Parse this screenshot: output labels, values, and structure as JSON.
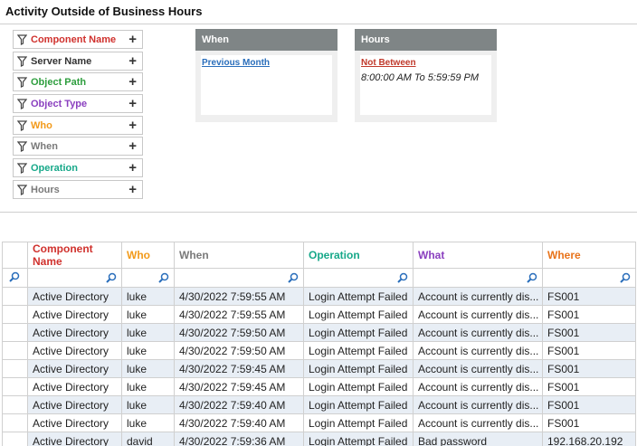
{
  "title": "Activity Outside of Business Hours",
  "colors": {
    "component": "#d0312d",
    "server": "#333333",
    "path": "#2e9e3e",
    "type": "#8a3fbf",
    "who": "#f29a1a",
    "when": "#7a7a7a",
    "operation": "#17a889",
    "hours": "#7a7a7a",
    "what": "#8a3fbf",
    "where": "#e8731a",
    "link_blue": "#2a6ebb",
    "link_red": "#c0392b"
  },
  "filters": [
    {
      "label": "Component Name",
      "plus": "+"
    },
    {
      "label": "Server Name",
      "plus": "+"
    },
    {
      "label": "Object Path",
      "plus": "+"
    },
    {
      "label": "Object Type",
      "plus": "+"
    },
    {
      "label": "Who",
      "plus": "+"
    },
    {
      "label": "When",
      "plus": "+"
    },
    {
      "label": "Operation",
      "plus": "+"
    },
    {
      "label": "Hours",
      "plus": "+"
    }
  ],
  "panels": {
    "when": {
      "title": "When",
      "link": "Previous Month"
    },
    "hours": {
      "title": "Hours",
      "link": "Not Between",
      "value": "8:00:00 AM To 5:59:59 PM"
    }
  },
  "grid": {
    "columns": [
      "Component Name",
      "Who",
      "When",
      "Operation",
      "What",
      "Where"
    ],
    "rows": [
      [
        "Active Directory",
        "luke",
        "4/30/2022 7:59:55 AM",
        "Login Attempt Failed",
        "Account is currently dis...",
        "FS001"
      ],
      [
        "Active Directory",
        "luke",
        "4/30/2022 7:59:55 AM",
        "Login Attempt Failed",
        "Account is currently dis...",
        "FS001"
      ],
      [
        "Active Directory",
        "luke",
        "4/30/2022 7:59:50 AM",
        "Login Attempt Failed",
        "Account is currently dis...",
        "FS001"
      ],
      [
        "Active Directory",
        "luke",
        "4/30/2022 7:59:50 AM",
        "Login Attempt Failed",
        "Account is currently dis...",
        "FS001"
      ],
      [
        "Active Directory",
        "luke",
        "4/30/2022 7:59:45 AM",
        "Login Attempt Failed",
        "Account is currently dis...",
        "FS001"
      ],
      [
        "Active Directory",
        "luke",
        "4/30/2022 7:59:45 AM",
        "Login Attempt Failed",
        "Account is currently dis...",
        "FS001"
      ],
      [
        "Active Directory",
        "luke",
        "4/30/2022 7:59:40 AM",
        "Login Attempt Failed",
        "Account is currently dis...",
        "FS001"
      ],
      [
        "Active Directory",
        "luke",
        "4/30/2022 7:59:40 AM",
        "Login Attempt Failed",
        "Account is currently dis...",
        "FS001"
      ],
      [
        "Active Directory",
        "david",
        "4/30/2022 7:59:36 AM",
        "Login Attempt Failed",
        "Bad password",
        "192.168.20.192"
      ]
    ]
  }
}
